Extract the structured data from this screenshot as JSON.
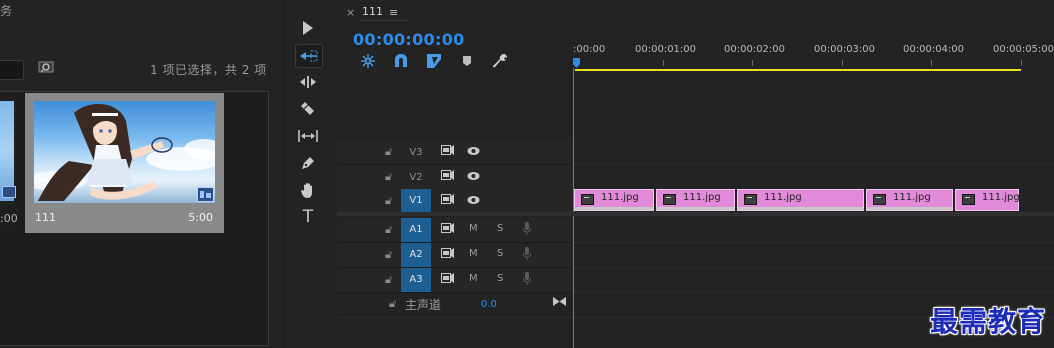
{
  "project": {
    "title_partial": "务",
    "selection_status": "1 项已选择，共 2 项",
    "partial_item": {
      "duration": ":00"
    },
    "clip": {
      "name": "111",
      "duration": "5:00"
    }
  },
  "tools": [
    {
      "name": "selection-tool",
      "active": false
    },
    {
      "name": "track-select-forward-tool",
      "active": true
    },
    {
      "name": "ripple-edit-tool",
      "active": false
    },
    {
      "name": "razor-tool",
      "active": false
    },
    {
      "name": "slip-tool",
      "active": false
    },
    {
      "name": "pen-tool",
      "active": false
    },
    {
      "name": "hand-tool",
      "active": false
    },
    {
      "name": "type-tool",
      "active": false,
      "glyph": "T"
    }
  ],
  "timeline": {
    "close_label": "×",
    "sequence_name": "111",
    "menu_glyph": "≡",
    "timecode": "00:00:00:00",
    "controls": [
      "nest-icon",
      "snap-icon",
      "linked-selection-icon",
      "add-marker-icon",
      "settings-wrench-icon"
    ],
    "ruler_labels": [
      ":00:00",
      "00:00:01:00",
      "00:00:02:00",
      "00:00:03:00",
      "00:00:04:00",
      "00:00:05:00"
    ],
    "colors": {
      "accent": "#2d8ceb",
      "clip": "#e18ad9",
      "work_area": "#e8e21e",
      "target": "#1d5e93"
    },
    "video_tracks": [
      {
        "name": "V3",
        "targeted": false
      },
      {
        "name": "V2",
        "targeted": false
      },
      {
        "name": "V1",
        "targeted": true
      }
    ],
    "audio_tracks": [
      {
        "name": "A1",
        "mute": "M",
        "solo": "S"
      },
      {
        "name": "A2",
        "mute": "M",
        "solo": "S"
      },
      {
        "name": "A3",
        "mute": "M",
        "solo": "S"
      }
    ],
    "clips": [
      {
        "label": "111.jpg"
      },
      {
        "label": "111.jpg"
      },
      {
        "label": "111.jpg"
      },
      {
        "label": "111.jpg"
      },
      {
        "label": "111.jpg"
      }
    ],
    "master": {
      "label": "主声道",
      "value": "0.0"
    }
  },
  "watermark": "最需教育"
}
